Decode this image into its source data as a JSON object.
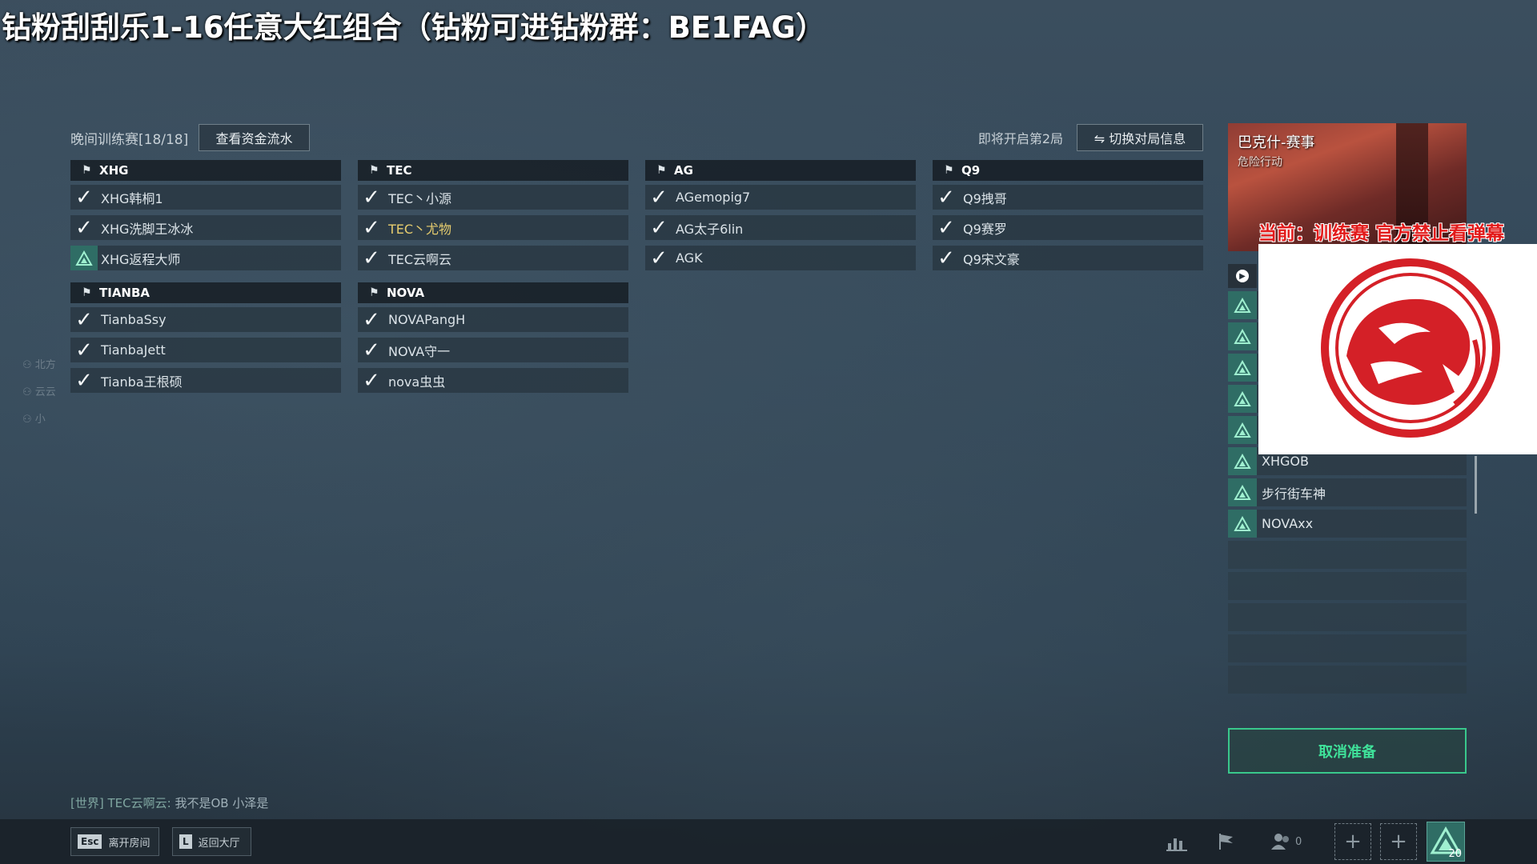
{
  "banner": {
    "text": "钻粉刮刮乐1-16任意大红组合（钻粉可进钻粉群：BE1FAG）"
  },
  "header": {
    "match_label": "晚间训练赛[18/18]",
    "fund_button": "查看资金流水",
    "round_label": "即将开启第2局",
    "switch_button": "⇋ 切换对局信息"
  },
  "teams": [
    {
      "name": "XHG",
      "players": [
        {
          "name": "XHG韩桐1",
          "status": "check"
        },
        {
          "name": "XHG洗脚王冰冰",
          "status": "check"
        },
        {
          "name": "XHG返程大师",
          "status": "triangle"
        }
      ]
    },
    {
      "name": "TEC",
      "players": [
        {
          "name": "TEC丶小源",
          "status": "check"
        },
        {
          "name": "TEC丶尤物",
          "status": "check",
          "highlight": true
        },
        {
          "name": "TEC云啊云",
          "status": "check"
        }
      ]
    },
    {
      "name": "AG",
      "players": [
        {
          "name": "AGemopig7",
          "status": "check"
        },
        {
          "name": "AG太子6lin",
          "status": "check"
        },
        {
          "name": "AGK",
          "status": "check"
        }
      ]
    },
    {
      "name": "Q9",
      "players": [
        {
          "name": "Q9拽哥",
          "status": "check"
        },
        {
          "name": "Q9赛罗",
          "status": "check"
        },
        {
          "name": "Q9宋文豪",
          "status": "check"
        }
      ]
    },
    {
      "name": "TIANBA",
      "players": [
        {
          "name": "TianbaSsy",
          "status": "check"
        },
        {
          "name": "TianbaJett",
          "status": "check"
        },
        {
          "name": "Tianba王根硕",
          "status": "check"
        }
      ]
    },
    {
      "name": "NOVA",
      "players": [
        {
          "name": "NOVAPangH",
          "status": "check"
        },
        {
          "name": "NOVA守一",
          "status": "check"
        },
        {
          "name": "nova虫虫",
          "status": "check"
        }
      ]
    }
  ],
  "map_card": {
    "name": "巴克什-赛事",
    "mode": "危险行动"
  },
  "overlay": {
    "red_text": "当前：训练赛   官方禁止看弹幕"
  },
  "observers": [
    {
      "name": ""
    },
    {
      "name": ""
    },
    {
      "name": ""
    },
    {
      "name": ""
    },
    {
      "name": ""
    },
    {
      "name": "XHGOB"
    },
    {
      "name": "步行街车神"
    },
    {
      "name": "NOVAxx"
    }
  ],
  "ready_button": "取消准备",
  "chat": {
    "channel": "[世界]",
    "sender": "TEC云啊云:",
    "message": "我不是OB 小泽是"
  },
  "bottom": {
    "leave": {
      "key": "Esc",
      "label": "离开房间"
    },
    "lobby": {
      "key": "L",
      "label": "返回大厅"
    },
    "friends_count": "0",
    "rank_number": "20"
  },
  "colors": {
    "accent_green": "#3fe29a",
    "highlight_gold": "#e6cc6e",
    "overlay_red": "#e21b1b"
  }
}
